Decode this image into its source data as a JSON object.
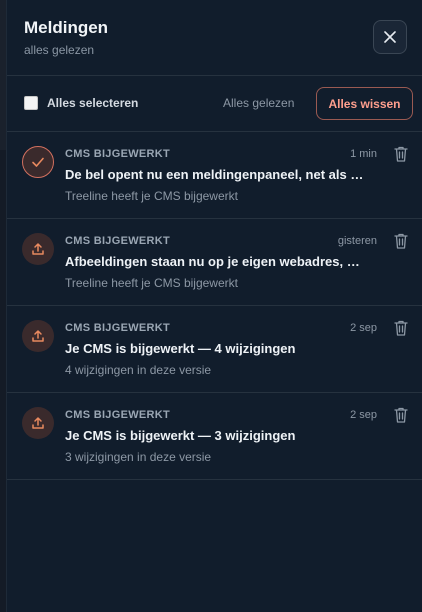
{
  "header": {
    "title": "Meldingen",
    "subtitle": "alles gelezen",
    "close_icon": "close-icon"
  },
  "toolbar": {
    "select_all_label": "Alles selecteren",
    "select_all_checked": false,
    "mark_read_label": "Alles gelezen",
    "clear_label": "Alles wissen"
  },
  "colors": {
    "accent": "#ff9f8e",
    "panel_bg": "#111d2c",
    "icon_orange": "#e8895f"
  },
  "notifications": [
    {
      "category": "CMS BIJGEWERKT",
      "time": "1 min",
      "headline": "De bel opent nu een meldingenpaneel, net als …",
      "desc": "Treeline heeft je CMS bijgewerkt",
      "icon": "check-icon",
      "selected": true
    },
    {
      "category": "CMS BIJGEWERKT",
      "time": "gisteren",
      "headline": "Afbeeldingen staan nu op je eigen webadres, …",
      "desc": "Treeline heeft je CMS bijgewerkt",
      "icon": "upload-icon",
      "selected": false
    },
    {
      "category": "CMS BIJGEWERKT",
      "time": "2 sep",
      "headline": "Je CMS is bijgewerkt — 4 wijzigingen",
      "desc": "4 wijzigingen in deze versie",
      "icon": "upload-icon",
      "selected": false
    },
    {
      "category": "CMS BIJGEWERKT",
      "time": "2 sep",
      "headline": "Je CMS is bijgewerkt — 3 wijzigingen",
      "desc": "3 wijzigingen in deze versie",
      "icon": "upload-icon",
      "selected": false
    }
  ]
}
